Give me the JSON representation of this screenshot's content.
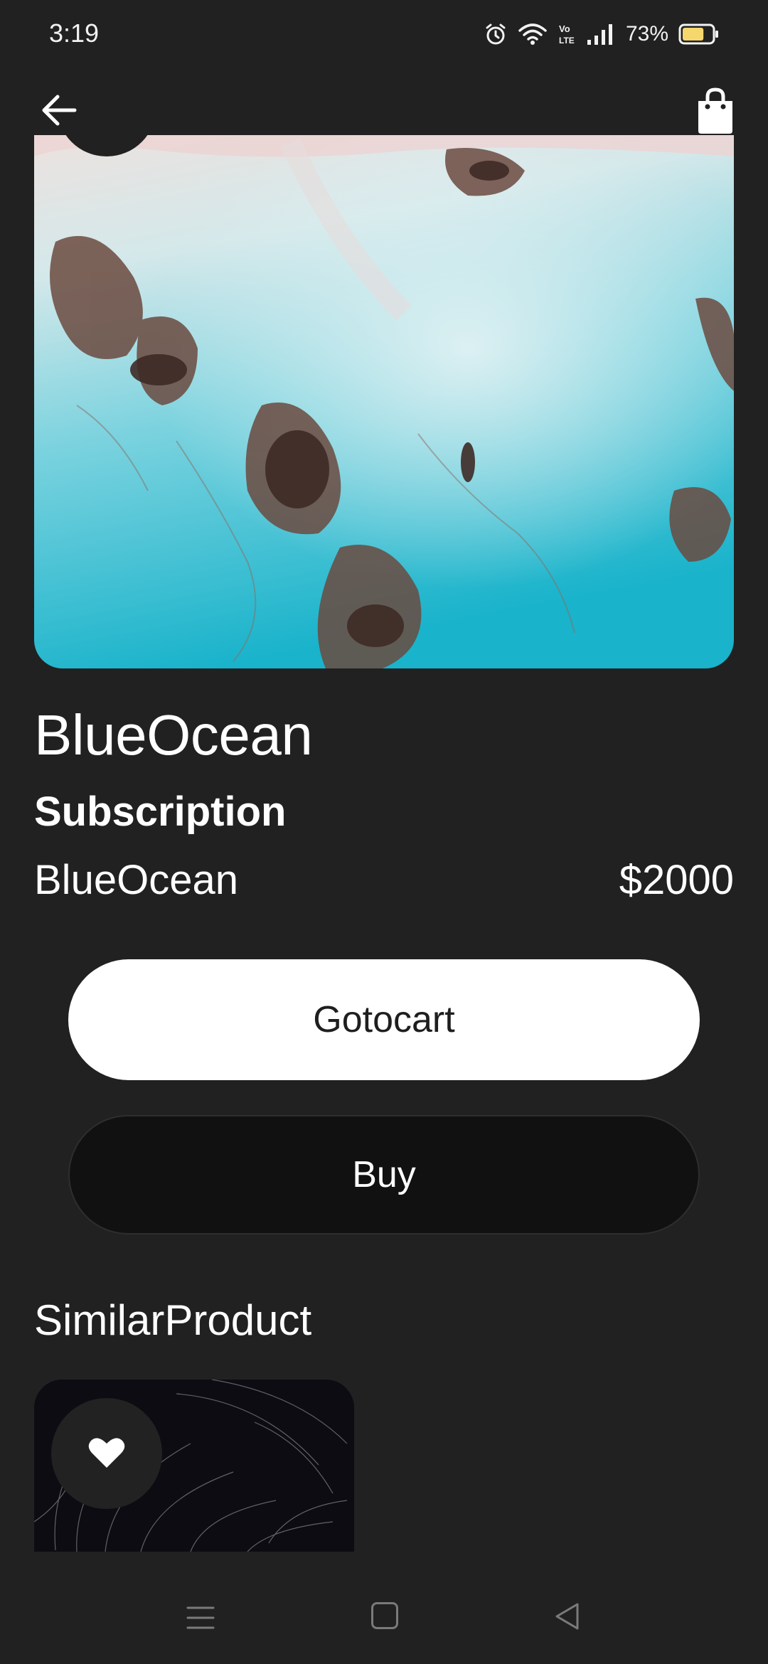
{
  "status_bar": {
    "time": "3:19",
    "battery_text": "73%",
    "battery_level": 0.73,
    "icons": [
      "alarm-icon",
      "wifi-icon",
      "volte-icon",
      "signal-icon",
      "battery-icon"
    ]
  },
  "header": {
    "back_icon": "arrow-left-icon",
    "cart_icon": "shopping-bag-icon"
  },
  "product": {
    "title": "BlueOcean",
    "type": "Subscription",
    "name": "BlueOcean",
    "price": "$2000"
  },
  "actions": {
    "goto_cart_label": "Gotocart",
    "buy_label": "Buy"
  },
  "similar": {
    "section_title": "SimilarProduct",
    "favorite_icon": "heart-icon"
  },
  "navbar": {
    "icons": [
      "menu-icon",
      "home-icon",
      "back-triangle-icon"
    ]
  },
  "colors": {
    "background": "#212121",
    "button_primary": "#ffffff",
    "button_secondary": "#111111",
    "battery_fill": "#f5d76e"
  }
}
